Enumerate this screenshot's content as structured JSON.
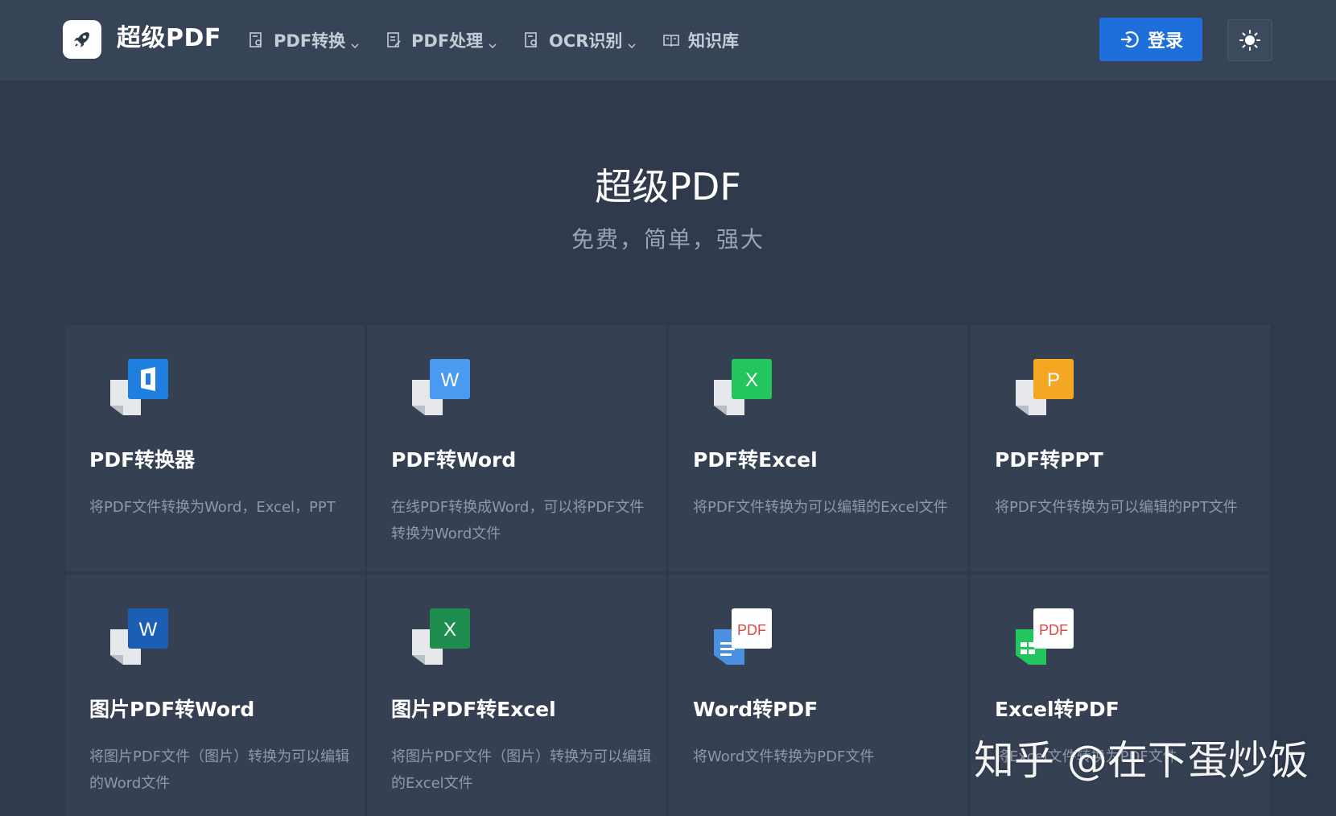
{
  "header": {
    "brand": "超级PDF",
    "nav": [
      {
        "label": "PDF转换",
        "has_dropdown": true,
        "icon": "document-search-icon"
      },
      {
        "label": "PDF处理",
        "has_dropdown": true,
        "icon": "document-edit-icon"
      },
      {
        "label": "OCR识别",
        "has_dropdown": true,
        "icon": "document-scan-icon"
      },
      {
        "label": "知识库",
        "has_dropdown": false,
        "icon": "book-icon"
      }
    ],
    "login_label": "登录",
    "theme_icon": "sun-icon"
  },
  "hero": {
    "title": "超级PDF",
    "subtitle": "免费，简单，强大"
  },
  "tools": [
    {
      "title": "PDF转换器",
      "desc": "将PDF文件转换为Word，Excel，PPT",
      "icon": "office-icon",
      "letter": "",
      "color": "#1e7fe0"
    },
    {
      "title": "PDF转Word",
      "desc": "在线PDF转换成Word，可以将PDF文件转换为Word文件",
      "icon": "word-icon",
      "letter": "W",
      "color": "#4a9af2"
    },
    {
      "title": "PDF转Excel",
      "desc": "将PDF文件转换为可以编辑的Excel文件",
      "icon": "excel-icon",
      "letter": "X",
      "color": "#22c55e"
    },
    {
      "title": "PDF转PPT",
      "desc": "将PDF文件转换为可以编辑的PPT文件",
      "icon": "ppt-icon",
      "letter": "P",
      "color": "#f5a623"
    },
    {
      "title": "图片PDF转Word",
      "desc": "将图片PDF文件（图片）转换为可以编辑的Word文件",
      "icon": "word-icon",
      "letter": "W",
      "color": "#1a5fb4"
    },
    {
      "title": "图片PDF转Excel",
      "desc": "将图片PDF文件（图片）转换为可以编辑的Excel文件",
      "icon": "excel-icon",
      "letter": "X",
      "color": "#1e8e4f"
    },
    {
      "title": "Word转PDF",
      "desc": "将Word文件转换为PDF文件",
      "icon": "pdf-icon",
      "letter": "PDF",
      "color": "#4a90e2"
    },
    {
      "title": "Excel转PDF",
      "desc": "将Excel文件转换为PDF文件",
      "icon": "pdf-icon",
      "letter": "PDF",
      "color": "#22c55e"
    }
  ],
  "watermark": "知乎 @在下蛋炒饭"
}
